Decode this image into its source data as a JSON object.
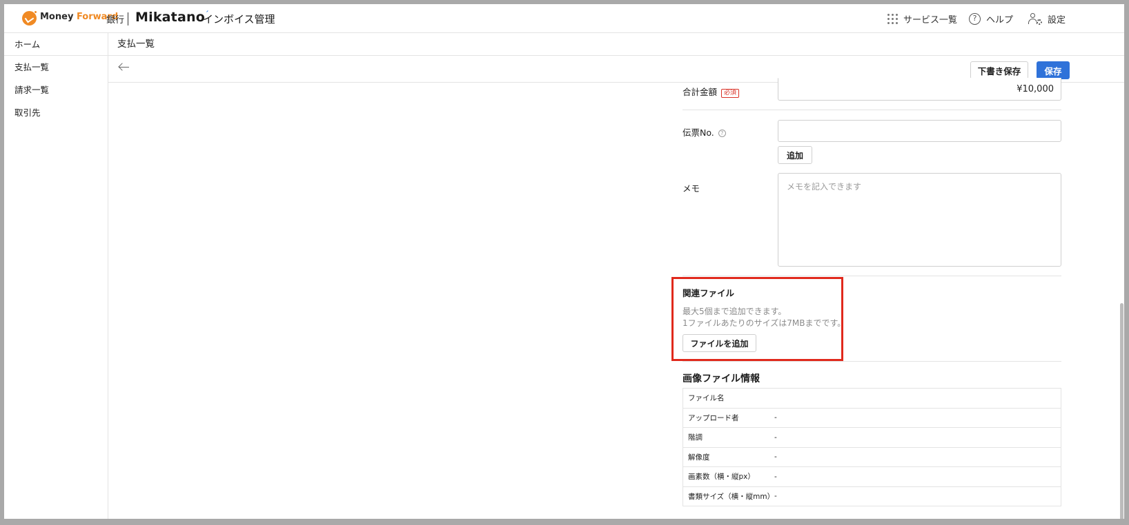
{
  "header": {
    "brand_money": "Money ",
    "brand_forward": "Forward",
    "brand_bank": "銀行",
    "brand_mikatano": "Mikatano",
    "brand_app": "インボイス管理",
    "nav": {
      "services_label": "サービス一覧",
      "help_label": "ヘルプ",
      "settings_label": "設定"
    }
  },
  "sidebar": {
    "items": [
      {
        "label": "ホーム"
      },
      {
        "label": "支払一覧"
      },
      {
        "label": "請求一覧"
      },
      {
        "label": "取引先"
      }
    ]
  },
  "main": {
    "page_title": "支払一覧",
    "toolbar": {
      "draft_save_label": "下書き保存",
      "save_label": "保存"
    },
    "form": {
      "total_amount_label": "合計金額",
      "required_badge": "必須",
      "total_amount_value": "¥10,000",
      "slip_no_label": "伝票No.",
      "slip_no_value": "",
      "add_label": "追加",
      "memo_label": "メモ",
      "memo_placeholder": "メモを記入できます"
    },
    "related_files": {
      "title": "関連ファイル",
      "note_line1": "最大5個まで追加できます。",
      "note_line2": "1ファイルあたりのサイズは7MBまでです。",
      "add_file_label": "ファイルを追加"
    },
    "image_info": {
      "title": "画像ファイル情報",
      "rows": [
        {
          "key": "ファイル名",
          "value": ""
        },
        {
          "key": "アップロード者",
          "value": "-"
        },
        {
          "key": "階調",
          "value": "-"
        },
        {
          "key": "解像度",
          "value": "-"
        },
        {
          "key": "画素数（横・縦px）",
          "value": "-"
        },
        {
          "key": "書類サイズ（横・縦mm）",
          "value": "-"
        }
      ]
    }
  },
  "colors": {
    "brand_orange": "#f08a24",
    "primary_blue": "#2f72d9",
    "required_red": "#d93025",
    "highlight_red": "#e0291c"
  }
}
